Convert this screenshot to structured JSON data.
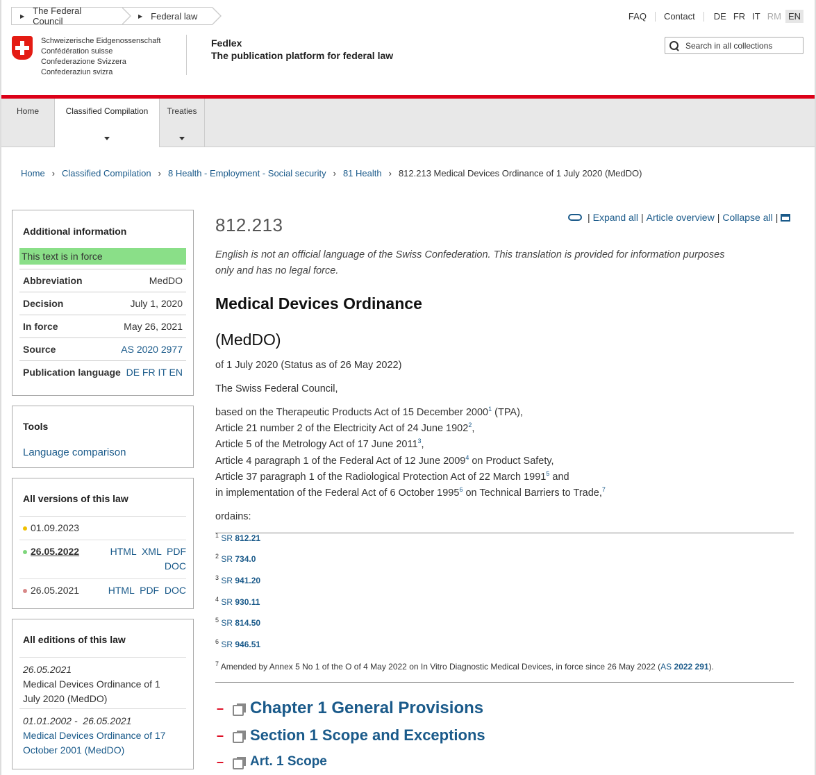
{
  "top_breadcrumb": [
    "The Federal Council",
    "Federal law"
  ],
  "top_links": {
    "faq": "FAQ",
    "contact": "Contact"
  },
  "languages": [
    {
      "code": "DE",
      "state": "normal"
    },
    {
      "code": "FR",
      "state": "normal"
    },
    {
      "code": "IT",
      "state": "normal"
    },
    {
      "code": "RM",
      "state": "disabled"
    },
    {
      "code": "EN",
      "state": "active"
    }
  ],
  "confederation": [
    "Schweizerische Eidgenossenschaft",
    "Confédération suisse",
    "Confederazione Svizzera",
    "Confederaziun svizra"
  ],
  "brand": {
    "name": "Fedlex",
    "tagline": "The publication platform for federal law"
  },
  "search": {
    "placeholder": "Search in all collections"
  },
  "nav": {
    "home": "Home",
    "classified": "Classified Compilation",
    "treaties": "Treaties"
  },
  "breadcrumb": [
    "Home",
    "Classified Compilation",
    "8 Health - Employment - Social security",
    "81 Health",
    "812.213 Medical Devices Ordinance of 1 July 2020 (MedDO)"
  ],
  "additional_info": {
    "title": "Additional information",
    "status": "This text is in force",
    "rows": [
      {
        "label": "Abbreviation",
        "value": "MedDO"
      },
      {
        "label": "Decision",
        "value": "July 1, 2020"
      },
      {
        "label": "In force",
        "value": "May 26, 2021"
      },
      {
        "label": "Source",
        "value": "AS 2020 2977"
      },
      {
        "label": "Publication language",
        "value": "DE FR IT EN"
      }
    ]
  },
  "tools": {
    "title": "Tools",
    "language_comparison": "Language comparison"
  },
  "versions": {
    "title": "All versions of this law",
    "items": [
      {
        "date": "01.09.2023",
        "dot_color": "#f0c000",
        "formats_line1": "",
        "formats_line2": ""
      },
      {
        "date": "26.05.2022",
        "dot_color": "#7ed67c",
        "formats_line1": "HTML  XML  PDF",
        "formats_line2": "DOC"
      },
      {
        "date": "26.05.2021",
        "dot_color": "#d88888",
        "formats_line1": "HTML  PDF  DOC",
        "formats_line2": ""
      }
    ]
  },
  "editions": {
    "title": "All editions of this law",
    "items": [
      {
        "dates": "26.05.2021",
        "name_line1": "Medical Devices Ordinance of 1",
        "name_line2": "July 2020 (MedDO)"
      },
      {
        "dates": "01.01.2002 -  26.05.2021",
        "name_line1": "Medical Devices Ordinance of 17",
        "name_line2": "October 2001 (MedDO)"
      }
    ]
  },
  "doc": {
    "sr_number": "812.213",
    "toolbar": {
      "expand": "Expand all",
      "overview": "Article overview",
      "collapse": "Collapse all"
    },
    "notice_line1": "English is not an official language of the Swiss Confederation. This translation is provided for information purposes",
    "notice_line2": "only and has no legal force.",
    "title": "Medical Devices Ordinance",
    "abbr": "(MedDO)",
    "date": "of 1 July 2020 (Status as of 26 May 2022)",
    "council": "The Swiss Federal Council,",
    "preamble": [
      {
        "text": "based on the Therapeutic Products Act of 15 December 2000",
        "fn": "1",
        "after": " (TPA),"
      },
      {
        "text": "Article 21 number 2 of the Electricity Act of 24 June 1902",
        "fn": "2",
        "after": ","
      },
      {
        "text": "Article 5 of the Metrology Act of 17 June 2011",
        "fn": "3",
        "after": ","
      },
      {
        "text": "Article 4 paragraph 1 of the Federal Act of 12 June 2009",
        "fn": "4",
        "after": " on Product Safety,"
      },
      {
        "text": "Article 37 paragraph 1 of the Radiological Protection Act of 22 March 1991",
        "fn": "5",
        "after": " and"
      },
      {
        "text": "in implementation of the Federal Act of 6 October 1995",
        "fn": "6",
        "after": " on Technical Barriers to Trade,"
      }
    ],
    "preamble_last_fn": "7",
    "ordains": "ordains:",
    "footnotes": [
      {
        "n": "1",
        "sr": "SR",
        "num": "812.21"
      },
      {
        "n": "2",
        "sr": "SR",
        "num": "734.0"
      },
      {
        "n": "3",
        "sr": "SR",
        "num": "941.20"
      },
      {
        "n": "4",
        "sr": "SR",
        "num": "930.11"
      },
      {
        "n": "5",
        "sr": "SR",
        "num": "814.50"
      },
      {
        "n": "6",
        "sr": "SR",
        "num": "946.51"
      }
    ],
    "fn7": {
      "n": "7",
      "text": "Amended by Annex 5 No 1 of the O of 4 May 2022 on In Vitro Diagnostic Medical Devices, in force since 26 May 2022 (",
      "as": "AS",
      "as_num": "2022 291",
      "end": ")."
    },
    "sections": [
      {
        "marker": "–",
        "label": "Chapter 1 General Provisions"
      },
      {
        "marker": "–",
        "label": "Section 1 Scope and Exceptions"
      },
      {
        "marker": "–",
        "label": "Art. 1 Scope"
      }
    ]
  }
}
